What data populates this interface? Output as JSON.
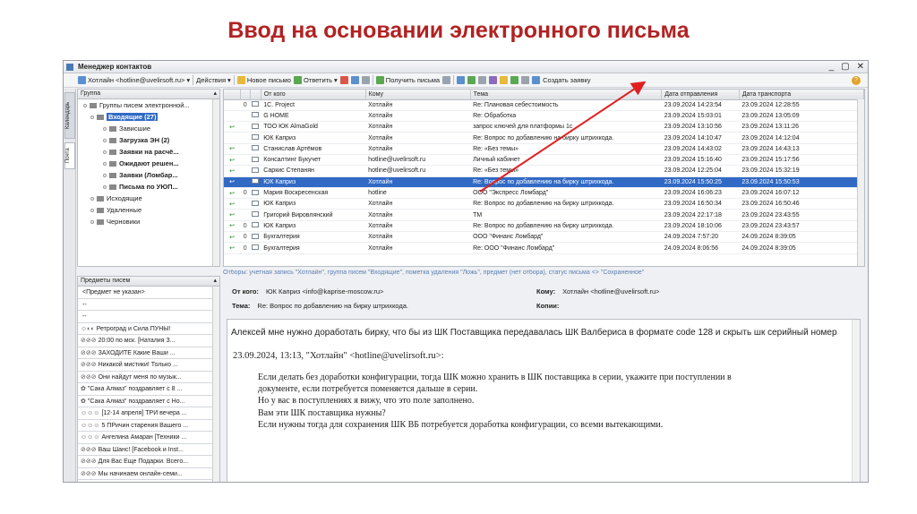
{
  "slide_title": "Ввод на основании электронного письма",
  "window": {
    "title": "Менеджер контактов",
    "controls": [
      "_",
      "▢",
      "✕"
    ]
  },
  "toolbar": {
    "account": "Хотлайн <hotline@uvelirsoft.ru>",
    "actions": "Действия",
    "new_letter": "Новое письмо",
    "reply": "Ответить",
    "get_letters": "Получить письма",
    "create_request": "Создать заявку",
    "help": "?"
  },
  "sidetabs": [
    "Календарь",
    "Почта"
  ],
  "groups": {
    "header": "Группа",
    "items": [
      {
        "label": "Группы писем электронной...",
        "style": "normal"
      },
      {
        "label": "Входящие (27)",
        "style": "selected"
      },
      {
        "label": "Зависшие",
        "style": "normal"
      },
      {
        "label": "Загрузка ЭН (2)",
        "style": "bold"
      },
      {
        "label": "Заявки на расчё...",
        "style": "bold"
      },
      {
        "label": "Ожидают решен...",
        "style": "bold"
      },
      {
        "label": "Заявки (Ломбар...",
        "style": "bold"
      },
      {
        "label": "Письма по УЮП...",
        "style": "bold"
      },
      {
        "label": "Исходящие",
        "style": "normal"
      },
      {
        "label": "Удаленные",
        "style": "normal"
      },
      {
        "label": "Черновики",
        "style": "normal"
      }
    ]
  },
  "subjects": {
    "header": "Предметы писем",
    "items": [
      {
        "mark": "",
        "text": "<Предмет не указан>"
      },
      {
        "mark": "",
        "text": "--"
      },
      {
        "mark": "",
        "text": "--"
      },
      {
        "mark": "☺◐◐",
        "text": "Ретроград и Сила ПУНЫ!"
      },
      {
        "mark": "⊘⊘⊘",
        "text": "20:00 по мск. [Наталия З..."
      },
      {
        "mark": "⊘⊘⊘",
        "text": "ЗАХОДИТЕ Какие Ваши ..."
      },
      {
        "mark": "⊘⊘⊘",
        "text": "Никакой мистики! Только ..."
      },
      {
        "mark": "⊘⊘⊘",
        "text": "Они найдут меня по музык..."
      },
      {
        "mark": "✿",
        "text": "\"Сака Алмаз\" поздравляет с 8 ..."
      },
      {
        "mark": "✿",
        "text": "\"Сака Алмаз\" поздравляет с Но..."
      },
      {
        "mark": "☺☺☺",
        "text": "[12-14 апреля] ТРИ вечера ..."
      },
      {
        "mark": "☺☺☺",
        "text": "5 ПРичин старения Вашего ..."
      },
      {
        "mark": "☺☺☺",
        "text": "Ангелина Амаран [Техники ..."
      },
      {
        "mark": "⊘⊘⊘",
        "text": "Ваш Шанс! [Facebook и Inst..."
      },
      {
        "mark": "⊘⊘⊘",
        "text": "Для Вас Еще Подарки. Всего..."
      },
      {
        "mark": "⊘⊘⊘",
        "text": "Мы начинаем онлайн-семи..."
      }
    ]
  },
  "mail_list": {
    "columns": [
      "",
      "",
      "",
      "От кого",
      "Кому",
      "Тема",
      "Дата отправления",
      "Дата транспорта"
    ],
    "rows": [
      {
        "arrow": "",
        "attach": "0",
        "from": "1С. Project",
        "to": "Хотлайн",
        "subject": "Re: Плановая себестоимость",
        "sent": "23.09.2024 14:23:54",
        "transport": "23.09.2024 12:28:55",
        "selected": false
      },
      {
        "arrow": "",
        "attach": "",
        "from": "G HOME",
        "to": "Хотлайн",
        "subject": "Re: Обработка",
        "sent": "23.09.2024 15:03:01",
        "transport": "23.09.2024 13:05:09",
        "selected": false
      },
      {
        "arrow": "↩",
        "attach": "",
        "from": "ТОО ЮК AlmaGold",
        "to": "Хотлайн",
        "subject": "запрос ключей для платформы 1с",
        "sent": "23.09.2024 13:10:56",
        "transport": "23.09.2024 13:11:26",
        "selected": false
      },
      {
        "arrow": "",
        "attach": "",
        "from": "ЮК Каприз",
        "to": "Хотлайн",
        "subject": "Re: Вопрос по добавлению на бирку штрихкода.",
        "sent": "23.09.2024 14:10:47",
        "transport": "23.09.2024 14:12:04",
        "selected": false
      },
      {
        "arrow": "↩",
        "attach": "",
        "from": "Станислав Артёмов",
        "to": "Хотлайн",
        "subject": "Re: «Без темы»",
        "sent": "23.09.2024 14:43:02",
        "transport": "23.09.2024 14:43:13",
        "selected": false
      },
      {
        "arrow": "↩",
        "attach": "",
        "from": "Консалтинг Букучет",
        "to": "hotline@uvelirsoft.ru",
        "subject": "Личный кабинет",
        "sent": "23.09.2024 15:16:40",
        "transport": "23.09.2024 15:17:56",
        "selected": false
      },
      {
        "arrow": "↩",
        "attach": "",
        "from": "Саркис Степанян",
        "to": "hotline@uvelirsoft.ru",
        "subject": "Re: «Без темы»",
        "sent": "23.09.2024 12:25:04",
        "transport": "23.09.2024 15:32:19",
        "selected": false
      },
      {
        "arrow": "↩",
        "attach": "",
        "from": "ЮК Каприз",
        "to": "Хотлайн",
        "subject": "Re: Вопрос по добавлению на бирку штрихкода.",
        "sent": "23.09.2024 15:50:25",
        "transport": "23.09.2024 15:50:53",
        "selected": true
      },
      {
        "arrow": "↩",
        "attach": "0",
        "from": "Мария Воскресенская",
        "to": "hotline",
        "subject": "ООО \"Экспресс Ломбард\"",
        "sent": "23.09.2024 16:06:23",
        "transport": "23.09.2024 16:07:12",
        "selected": false
      },
      {
        "arrow": "↩",
        "attach": "",
        "from": "ЮК Каприз",
        "to": "Хотлайн",
        "subject": "Re: Вопрос по добавлению на бирку штрихкода.",
        "sent": "23.09.2024 16:50:34",
        "transport": "23.09.2024 16:50:46",
        "selected": false
      },
      {
        "arrow": "↩",
        "attach": "",
        "from": "Григорий Вировлянский",
        "to": "Хотлайн",
        "subject": "ТМ",
        "sent": "23.09.2024 22:17:18",
        "transport": "23.09.2024 23:43:55",
        "selected": false
      },
      {
        "arrow": "↩",
        "attach": "0",
        "from": "ЮК Каприз",
        "to": "Хотлайн",
        "subject": "Re: Вопрос по добавлению на бирку штрихкода.",
        "sent": "23.09.2024 18:10:06",
        "transport": "23.09.2024 23:43:57",
        "selected": false
      },
      {
        "arrow": "↩",
        "attach": "0",
        "from": "Бухгалтерия",
        "to": "Хотлайн",
        "subject": "ООО \"Финанс Ломбард\"",
        "sent": "24.09.2024 7:57:20",
        "transport": "24.09.2024 8:39:05",
        "selected": false
      },
      {
        "arrow": "↩",
        "attach": "0",
        "from": "Бухгалтерия",
        "to": "Хотлайн",
        "subject": "Re: ООО \"Финанс Ломбард\"",
        "sent": "24.09.2024 8:06:56",
        "transport": "24.09.2024 8:39:05",
        "selected": false
      }
    ]
  },
  "filter_text": "Отборы: учетная запись \"Хотлайн\", группа писем \"Входящие\", пометка удаления \"Ложь\", предмет (нет отбора), статус письма <> \"Сохраненное\"",
  "header": {
    "from_label": "От кого:",
    "from_value": "ЮК Каприз <info@kaprise-moscow.ru>",
    "to_label": "Кому:",
    "to_value": "Хотлайн <hotline@uvelirsoft.ru>",
    "subject_label": "Тема:",
    "subject_value": "Re: Вопрос по добавлению на бирку штрихкода.",
    "cc_label": "Копии:"
  },
  "body": {
    "line1": "Алексей мне нужно доработать бирку, что бы из ШК Поставщика передавалась  ШК Валбериса в формате code 128 и скрыть шк серийный номер",
    "quote_header": "23.09.2024, 13:13, \"Хотлайн\" <hotline@uvelirsoft.ru>:",
    "quote_lines": [
      "Если делать без доработки конфигурации, тогда ШК можно хранить в ШК поставщика в серии, укажите при поступлении в",
      "документе, если потребуется поменяется дальше в серии.",
      "Но у вас в поступлениях я вижу, что это поле заполнено.",
      "Вам эти ШК поставщика нужны?",
      "Если нужны тогда для сохранения ШК ВБ потребуется доработка конфигурации, со всеми вытекающими."
    ]
  },
  "colors": {
    "title": "#b22222",
    "selection": "#316ac5",
    "arrow": "#e02020"
  }
}
